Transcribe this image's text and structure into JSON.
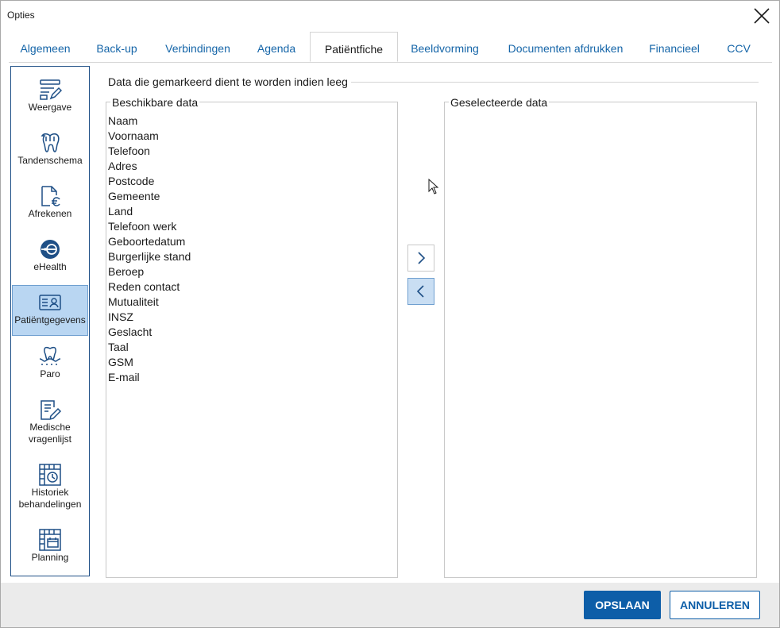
{
  "window": {
    "title": "Opties"
  },
  "tabs": [
    {
      "label": "Algemeen"
    },
    {
      "label": "Back-up"
    },
    {
      "label": "Verbindingen"
    },
    {
      "label": "Agenda"
    },
    {
      "label": "Patiëntfiche",
      "active": true
    },
    {
      "label": "Beeldvorming"
    },
    {
      "label": "Documenten afdrukken"
    },
    {
      "label": "Financieel"
    },
    {
      "label": "CCV"
    }
  ],
  "sidebar": {
    "items": [
      {
        "label": "Weergave",
        "icon": "display-settings-icon"
      },
      {
        "label": "Tandenschema",
        "icon": "tooth-icon"
      },
      {
        "label": "Afrekenen",
        "icon": "euro-document-icon"
      },
      {
        "label": "eHealth",
        "icon": "ehealth-icon"
      },
      {
        "label": "Patiëntgegevens",
        "icon": "id-card-icon",
        "active": true
      },
      {
        "label": "Paro",
        "icon": "gum-tooth-icon"
      },
      {
        "label": "Medische vragenlijst",
        "label_line1": "Medische",
        "label_line2": "vragenlijst",
        "icon": "questionnaire-icon"
      },
      {
        "label": "Historiek behandelingen",
        "label_line1": "Historiek",
        "label_line2": "behandelingen",
        "icon": "history-calendar-icon"
      },
      {
        "label": "Planning",
        "icon": "calendar-icon"
      }
    ]
  },
  "section": {
    "title": "Data die gemarkeerd dient te worden indien leeg"
  },
  "available": {
    "title": "Beschikbare data",
    "items": [
      "Naam",
      "Voornaam",
      "Telefoon",
      "Adres",
      "Postcode",
      "Gemeente",
      "Land",
      "Telefoon werk",
      "Geboortedatum",
      "Burgerlijke stand",
      "Beroep",
      "Reden contact",
      "Mutualiteit",
      "INSZ",
      "Geslacht",
      "Taal",
      "GSM",
      "E-mail"
    ]
  },
  "selected": {
    "title": "Geselecteerde data",
    "items": []
  },
  "buttons": {
    "add": "chevron-right-icon",
    "remove": "chevron-left-icon",
    "save": "OPSLAAN",
    "cancel": "ANNULEREN"
  },
  "colors": {
    "accent": "#0d5ea8",
    "tab_text": "#1565a8",
    "sidebar_active": "#b9d6f2",
    "footer_bg": "#ebebeb"
  }
}
